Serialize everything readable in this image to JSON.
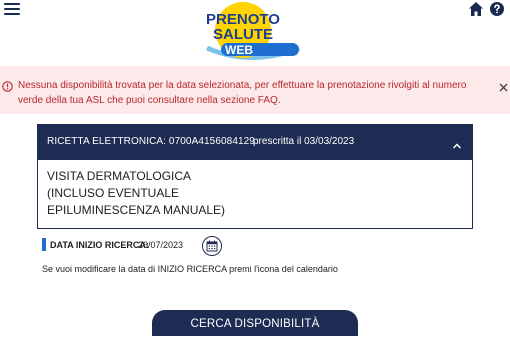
{
  "header": {
    "logo_line1": "PRENOTO",
    "logo_line2": "SALUTE",
    "logo_line3": "WEB",
    "icons": [
      "menu-icon",
      "home-icon",
      "help-icon"
    ]
  },
  "alert": {
    "message": "Nessuna disponibilità trovata per la data selezionata, per effettuare la prenotazione rivolgiti al numero verde della tua ASL che puoi consultare nella sezione FAQ.",
    "close_label": "×",
    "color": "#b8282e",
    "background": "#fce9e9"
  },
  "prescription": {
    "label": "RICETTA ELETTRONICA: 0700A4156084129",
    "prescribed": "prescritta il 03/03/2023",
    "visit": "VISITA DERMATOLOGICA\n(INCLUSO EVENTUALE\nEPILUMINESCENZA MANUALE)"
  },
  "search_start": {
    "label": "DATA INIZIO RICERCA:",
    "value": "26/07/2023",
    "hint": "Se vuoi modificare la data di INIZIO RICERCA premi l'icona del calendario"
  },
  "actions": {
    "search_label": "CERCA DISPONIBILITÀ"
  },
  "colors": {
    "navy": "#1e2b52",
    "accent_blue": "#1e6fd0",
    "logo_yellow": "#ffd400"
  }
}
